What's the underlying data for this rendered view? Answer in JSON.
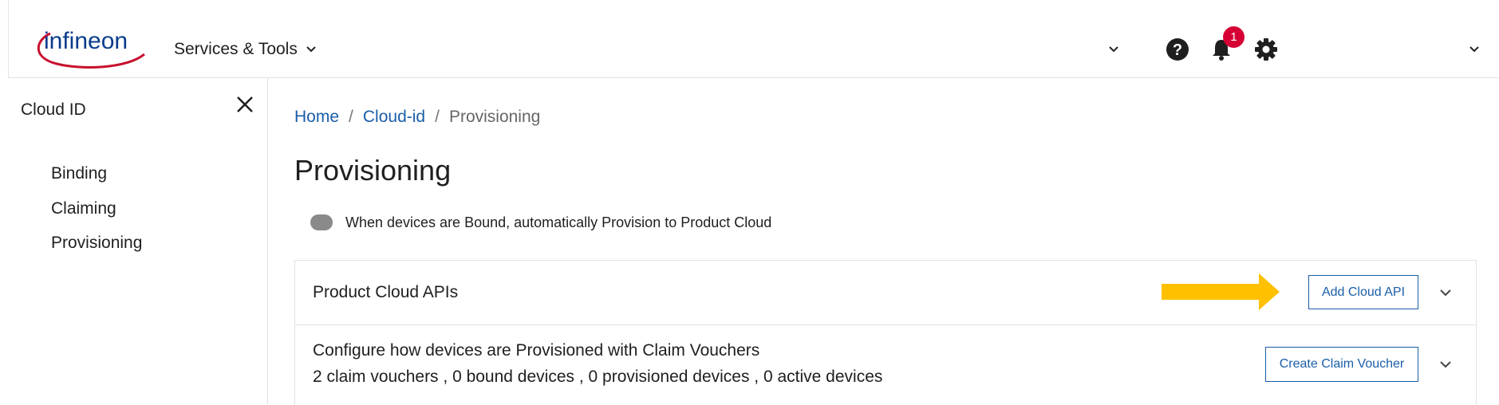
{
  "header": {
    "logo_text": "infineon",
    "services_label": "Services & Tools",
    "notification_count": "1",
    "colors": {
      "brand_blue": "#0a3c8c",
      "brand_red": "#c8102e",
      "badge_red": "#d60034"
    }
  },
  "sidebar": {
    "title": "Cloud ID",
    "items": [
      {
        "label": "Binding"
      },
      {
        "label": "Claiming"
      },
      {
        "label": "Provisioning"
      }
    ]
  },
  "breadcrumb": {
    "items": [
      {
        "label": "Home"
      },
      {
        "label": "Cloud-id"
      },
      {
        "label": "Provisioning"
      }
    ],
    "separator": "/"
  },
  "main": {
    "title": "Provisioning",
    "toggle_label": "When devices are Bound, automatically Provision to Product Cloud",
    "toggle_on": false,
    "panels": [
      {
        "title": "Product Cloud APIs",
        "button_label": "Add Cloud API"
      },
      {
        "title": "Configure how devices are Provisioned with Claim Vouchers",
        "subtitle": "2 claim vouchers , 0 bound devices , 0 provisioned devices , 0 active devices",
        "button_label": "Create Claim Voucher"
      }
    ]
  },
  "icons": {
    "help": "help-circle-icon",
    "bell": "bell-icon",
    "gear": "gear-icon",
    "close": "close-icon",
    "chevron": "chevron-down-icon",
    "annotation_arrow": "arrow-right-icon",
    "annotation_arrow_color": "#ffc000"
  },
  "accent_color": "#1a5ea8"
}
